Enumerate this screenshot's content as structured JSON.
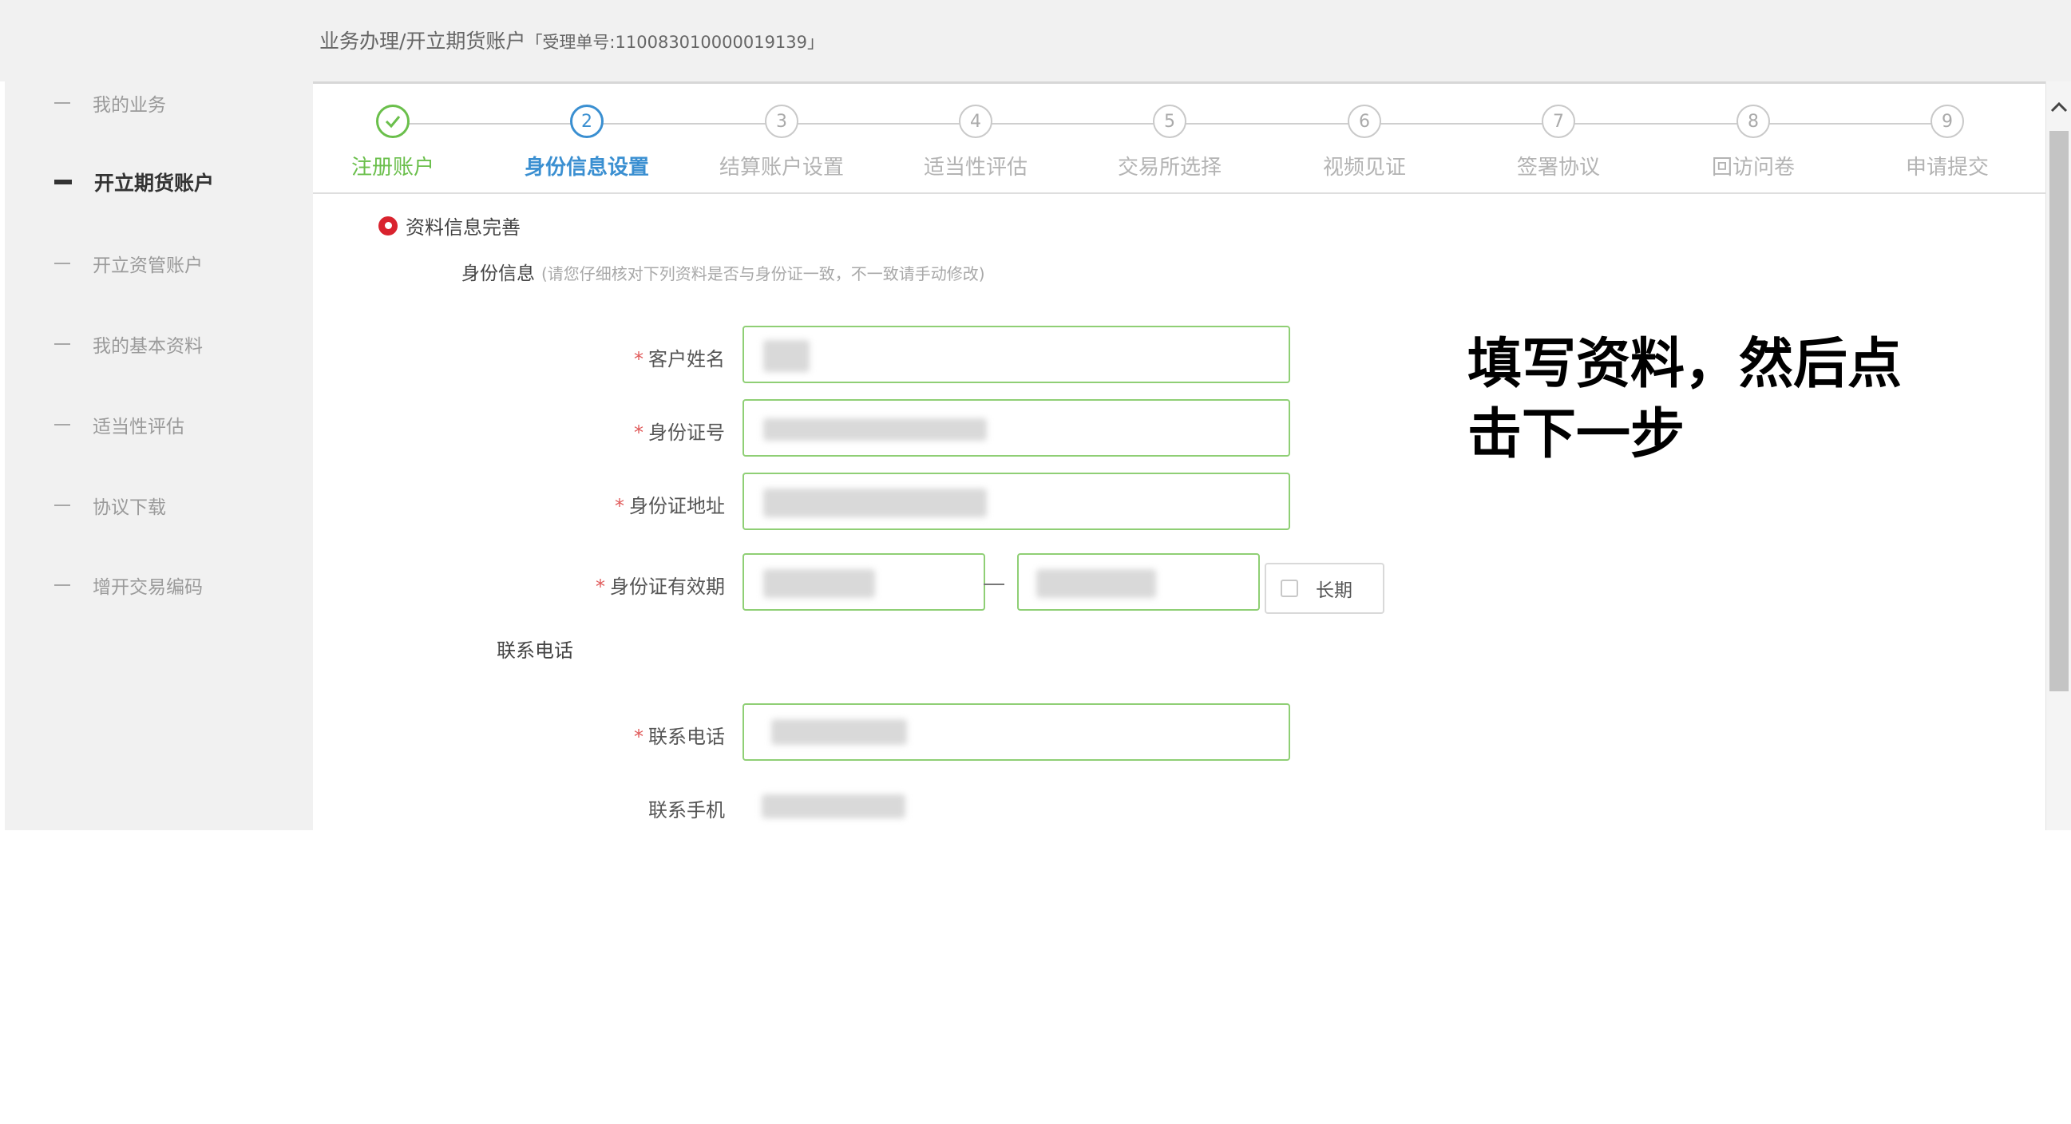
{
  "breadcrumb": {
    "path": "业务办理/开立期货账户",
    "ticket": "「受理单号:110083010000019139」"
  },
  "sidebar": {
    "items": [
      {
        "label": "我的业务",
        "active": false
      },
      {
        "label": "开立期货账户",
        "active": true
      },
      {
        "label": "开立资管账户",
        "active": false
      },
      {
        "label": "我的基本资料",
        "active": false
      },
      {
        "label": "适当性评估",
        "active": false
      },
      {
        "label": "协议下载",
        "active": false
      },
      {
        "label": "增开交易编码",
        "active": false
      }
    ]
  },
  "stepper": {
    "steps": [
      {
        "num": "✓",
        "label": "注册账户",
        "state": "done"
      },
      {
        "num": "2",
        "label": "身份信息设置",
        "state": "active"
      },
      {
        "num": "3",
        "label": "结算账户设置",
        "state": "todo"
      },
      {
        "num": "4",
        "label": "适当性评估",
        "state": "todo"
      },
      {
        "num": "5",
        "label": "交易所选择",
        "state": "todo"
      },
      {
        "num": "6",
        "label": "视频见证",
        "state": "todo"
      },
      {
        "num": "7",
        "label": "签署协议",
        "state": "todo"
      },
      {
        "num": "8",
        "label": "回访问卷",
        "state": "todo"
      },
      {
        "num": "9",
        "label": "申请提交",
        "state": "todo"
      }
    ]
  },
  "form": {
    "section_title": "资料信息完善",
    "id_heading": "身份信息",
    "id_hint": "(请您仔细核对下列资料是否与身份证一致，不一致请手动修改)",
    "required_mark": "*",
    "name_label": "客户姓名",
    "id_label": "身份证号",
    "address_label": "身份证地址",
    "validity_label": "身份证有效期",
    "long_term_label": "长期",
    "contact_heading": "联系电话",
    "phone_label": "联系电话",
    "mobile_label": "联系手机"
  },
  "annotation": {
    "line1": "填写资料，然后点",
    "line2": "击下一步"
  },
  "icons": {
    "scroll_up": "chevron-up-icon",
    "step_done": "check-icon",
    "section_marker": "radio-dot-icon"
  },
  "colors": {
    "done": "#6abf4b",
    "active": "#3a8fd1",
    "required": "#e05a5a",
    "field_border": "#8fcf75",
    "section_dot": "#d9232e"
  }
}
